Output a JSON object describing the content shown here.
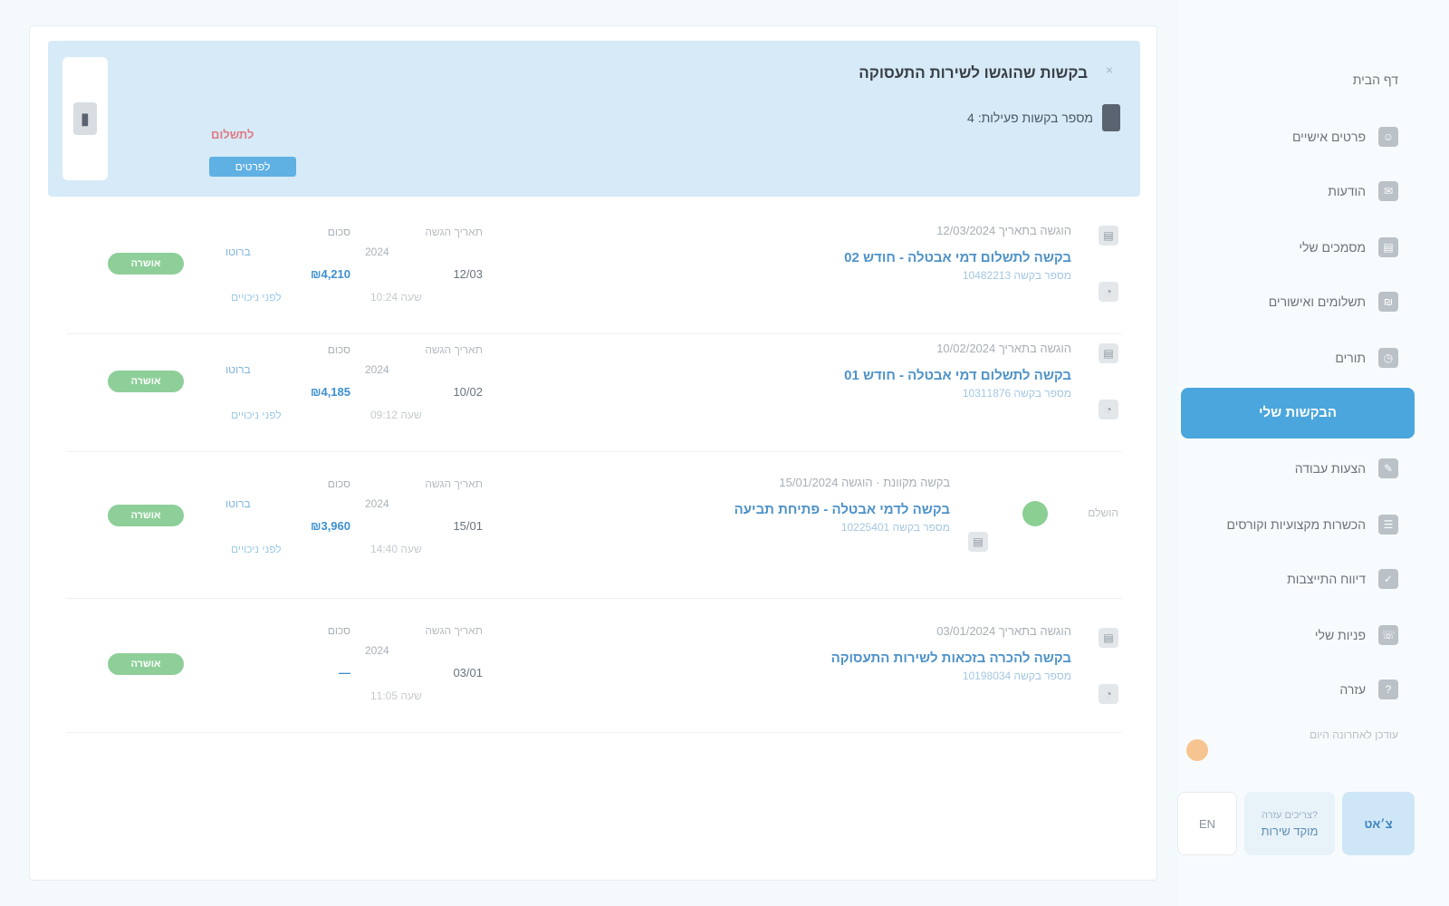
{
  "summary": {
    "title": "בקשות שהוגשו לשירות התעסוקה",
    "subtitle": "מספר בקשות פעילות: 4",
    "due_label": "לתשלום",
    "pay_link": "לפרטים",
    "close_glyph": "×",
    "rail_glyph": "▮"
  },
  "requests": [
    {
      "meta": "הוגשה בתאריך 12/03/2024",
      "title": "בקשה לתשלום דמי אבטלה - חודש 02",
      "ref": "מספר בקשה 10482213",
      "date_label": "תאריך הגשה",
      "date_value": "12/03",
      "date_sub": "2024",
      "date_sub2": "שעה 10:24",
      "amount_label": "סכום",
      "amount_value": "₪4,210",
      "amount_sub": "ברוטו",
      "amount_sub2": "לפני ניכויים",
      "status": "אושרה",
      "icon1": "▤",
      "icon2": "◔"
    },
    {
      "meta": "הוגשה בתאריך 10/02/2024",
      "title": "בקשה לתשלום דמי אבטלה - חודש 01",
      "ref": "מספר בקשה 10311876",
      "date_label": "תאריך הגשה",
      "date_value": "10/02",
      "date_sub": "2024",
      "date_sub2": "שעה 09:12",
      "amount_label": "סכום",
      "amount_value": "₪4,185",
      "amount_sub": "ברוטו",
      "amount_sub2": "לפני ניכויים",
      "status": "אושרה",
      "icon1": "▤",
      "icon2": "◔"
    },
    {
      "meta": "בקשה מקוונת · הוגשה 15/01/2024",
      "title": "בקשה לדמי אבטלה - פתיחת תביעה",
      "ref": "מספר בקשה 10225401",
      "date_label": "תאריך הגשה",
      "date_value": "15/01",
      "date_sub": "2024",
      "date_sub2": "שעה 14:40",
      "amount_label": "סכום",
      "amount_value": "₪3,960",
      "amount_sub": "ברוטו",
      "amount_sub2": "לפני ניכויים",
      "status": "אושרה",
      "ok_label": "הושלם",
      "icon1": "▤"
    },
    {
      "meta": "הוגשה בתאריך 03/01/2024",
      "title": "בקשה להכרה בזכאות לשירות התעסוקה",
      "ref": "מספר בקשה 10198034",
      "date_label": "תאריך הגשה",
      "date_value": "03/01",
      "date_sub": "2024",
      "date_sub2": "שעה 11:05",
      "amount_label": "סכום",
      "amount_value": "—",
      "status": "אושרה",
      "icon1": "▤",
      "icon2": "◔"
    }
  ],
  "sidebar": {
    "items": [
      {
        "label": "דף הבית",
        "icon": "⌂"
      },
      {
        "label": "פרטים אישיים",
        "icon": "☺"
      },
      {
        "label": "הודעות",
        "icon": "✉"
      },
      {
        "label": "מסמכים שלי",
        "icon": "▤"
      },
      {
        "label": "תשלומים ואישורים",
        "icon": "₪"
      },
      {
        "label": "תורים",
        "icon": "◷"
      }
    ],
    "active": "הבקשות שלי",
    "items_after": [
      {
        "label": "הצעות עבודה",
        "icon": "✎"
      },
      {
        "label": "הכשרות מקצועיות וקורסים",
        "icon": "☰"
      },
      {
        "label": "דיווח התייצבות",
        "icon": "✓"
      },
      {
        "label": "פניות שלי",
        "icon": "☏"
      },
      {
        "label": "עזרה",
        "icon": "?"
      }
    ],
    "note": "עודכן לאחרונה היום"
  },
  "footer": {
    "lang": "EN",
    "help_small": "צריכים עזרה?",
    "help": "מוקד שירות",
    "call": "צ׳אט"
  },
  "colors": {
    "accent": "#4aa6dc",
    "summary_bg": "#d6eaf7",
    "status_ok": "#8ecf99",
    "link": "#4e92c8"
  }
}
